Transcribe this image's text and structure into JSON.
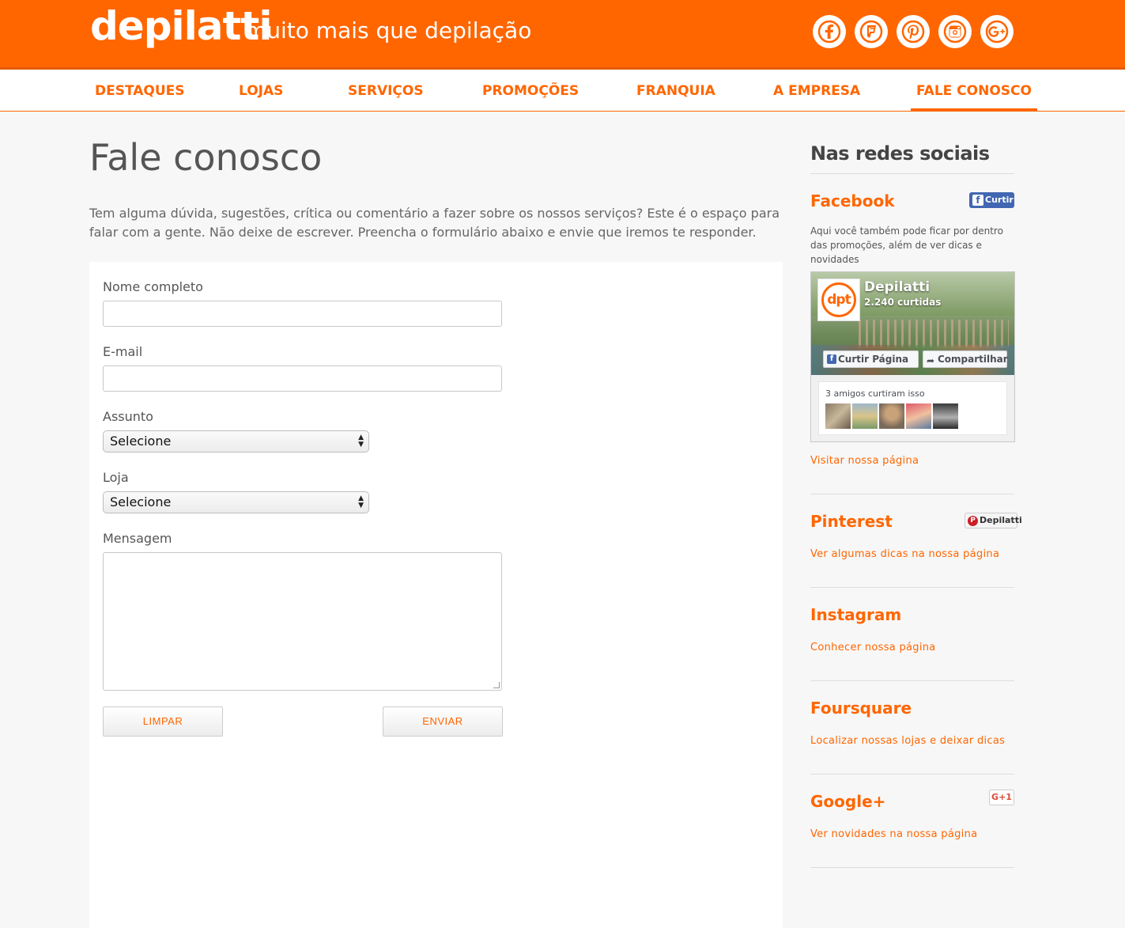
{
  "header": {
    "logo": "depilatti",
    "tagline": "muito mais que depilação",
    "brand_color": "#ff6600",
    "social_icons": [
      "facebook-icon",
      "foursquare-icon",
      "pinterest-icon",
      "instagram-icon",
      "google-plus-icon"
    ]
  },
  "nav": {
    "items": [
      {
        "label": "DESTAQUES"
      },
      {
        "label": "LOJAS"
      },
      {
        "label": "SERVIÇOS"
      },
      {
        "label": "PROMOÇÕES"
      },
      {
        "label": "FRANQUIA"
      },
      {
        "label": "A EMPRESA"
      },
      {
        "label": "FALE CONOSCO"
      }
    ],
    "active": "FALE CONOSCO"
  },
  "main": {
    "title": "Fale conosco",
    "intro": "Tem alguma dúvida, sugestões, crítica ou comentário a fazer sobre os nossos serviços? Este é o espaço para falar com a gente. Não deixe de escrever. Preencha o formulário abaixo e envie que iremos te responder.",
    "form": {
      "name_label": "Nome completo",
      "name_value": "",
      "email_label": "E-mail",
      "email_value": "",
      "subject_label": "Assunto",
      "subject_value": "Selecione",
      "store_label": "Loja",
      "store_value": "Selecione",
      "message_label": "Mensagem",
      "message_value": "",
      "clear_label": "LIMPAR",
      "send_label": "ENVIAR"
    }
  },
  "sidebar": {
    "title": "Nas redes sociais",
    "facebook": {
      "title": "Facebook",
      "like_button": "Curtir",
      "description": "Aqui você também pode ficar por dentro das promoções, além de ver dicas e novidades",
      "widget": {
        "logo_text": "dpt",
        "page_name": "Depilatti",
        "likes": "2.240 curtidas",
        "like_page": "Curtir Página",
        "share": "Compartilhar",
        "friends": "3 amigos curtiram isso"
      },
      "link": "Visitar nossa página"
    },
    "pinterest": {
      "title": "Pinterest",
      "button": "Depilatti",
      "link": "Ver algumas dicas na nossa página"
    },
    "instagram": {
      "title": "Instagram",
      "link": "Conhecer nossa página"
    },
    "foursquare": {
      "title": "Foursquare",
      "link": "Localizar nossas lojas e deixar dicas"
    },
    "googleplus": {
      "title": "Google+",
      "button": "G+1",
      "link": "Ver novidades na nossa página"
    }
  }
}
